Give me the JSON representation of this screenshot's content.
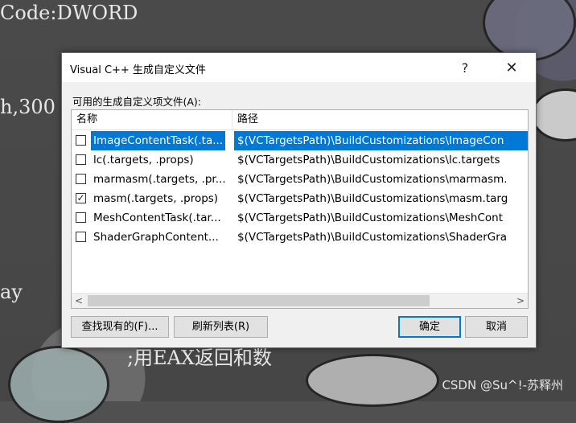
{
  "background": {
    "lines": [
      "Code:DWORD",
      "h,300",
      "ay",
      ";用EAX返回和数"
    ],
    "watermark": "CSDN @Su^!-苏释州"
  },
  "dialog": {
    "title": "Visual C++ 生成自定义文件",
    "help_glyph": "?",
    "close_glyph": "✕",
    "list_label": "可用的生成自定义项文件(A):",
    "columns": {
      "name": "名称",
      "path": "路径"
    },
    "rows": [
      {
        "checked": false,
        "selected": true,
        "check_glyph": "",
        "name": "ImageContentTask(.ta...",
        "path": "$(VCTargetsPath)\\BuildCustomizations\\ImageCon"
      },
      {
        "checked": false,
        "selected": false,
        "check_glyph": "",
        "name": "lc(.targets, .props)",
        "path": "$(VCTargetsPath)\\BuildCustomizations\\lc.targets"
      },
      {
        "checked": false,
        "selected": false,
        "check_glyph": "",
        "name": "marmasm(.targets, .pr...",
        "path": "$(VCTargetsPath)\\BuildCustomizations\\marmasm."
      },
      {
        "checked": true,
        "selected": false,
        "check_glyph": "✓",
        "name": "masm(.targets, .props)",
        "path": "$(VCTargetsPath)\\BuildCustomizations\\masm.targ"
      },
      {
        "checked": false,
        "selected": false,
        "check_glyph": "",
        "name": "MeshContentTask(.tar...",
        "path": "$(VCTargetsPath)\\BuildCustomizations\\MeshCont"
      },
      {
        "checked": false,
        "selected": false,
        "check_glyph": "",
        "name": "ShaderGraphContent...",
        "path": "$(VCTargetsPath)\\BuildCustomizations\\ShaderGra"
      }
    ],
    "scroll": {
      "left_arrow": "<",
      "right_arrow": ">"
    },
    "buttons": {
      "find": "查找现有的(F)...",
      "refresh": "刷新列表(R)",
      "ok": "确定",
      "cancel": "取消"
    },
    "colors": {
      "selection": "#0078d7",
      "default_button_border": "#0078d7"
    }
  }
}
